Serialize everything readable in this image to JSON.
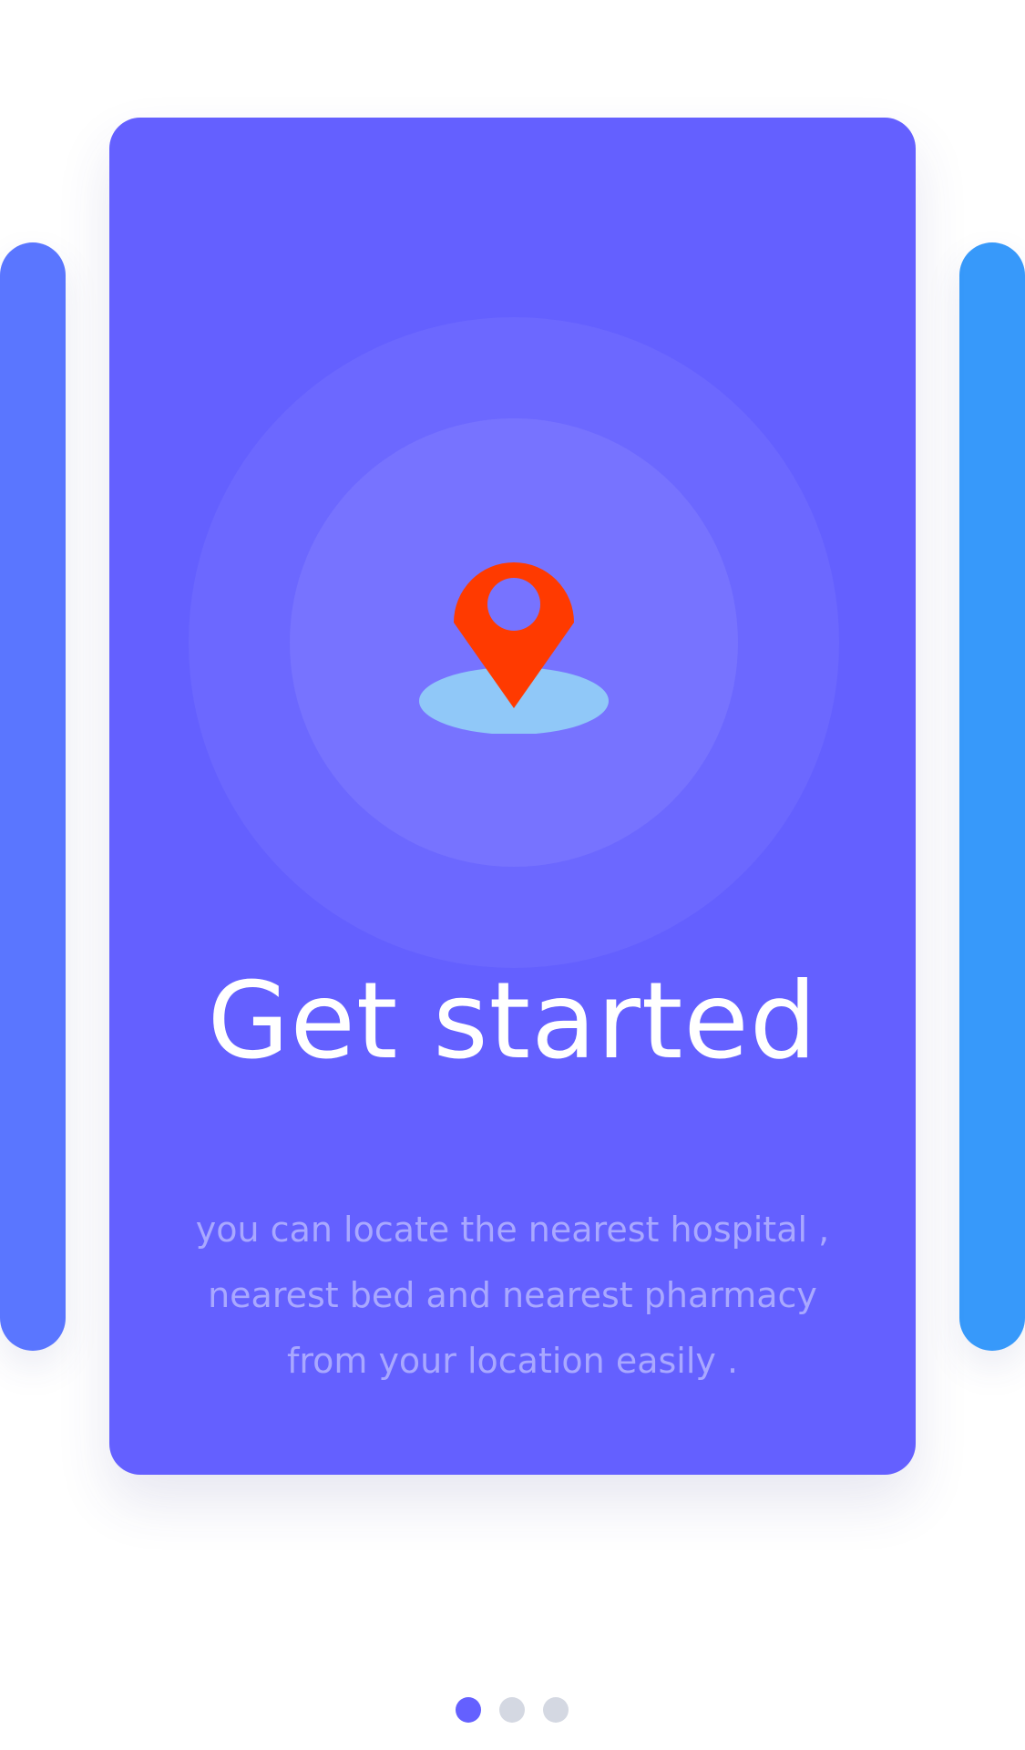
{
  "onboarding": {
    "title": "Get started",
    "description_lines": [
      "you can locate the nearest hospital ,",
      "nearest bed and nearest pharmacy",
      "from your location easily ."
    ],
    "illustration_icon": "map-pin-icon"
  },
  "pager": {
    "total": 3,
    "active_index": 0
  },
  "colors": {
    "card_primary": "#6460ff",
    "card_left": "#5a76ff",
    "card_right": "#3799fa",
    "pin": "#ff3a00",
    "pin_shadow": "#90c8f8",
    "dot_active": "#6460ff",
    "dot_inactive": "#d4d8e2"
  }
}
